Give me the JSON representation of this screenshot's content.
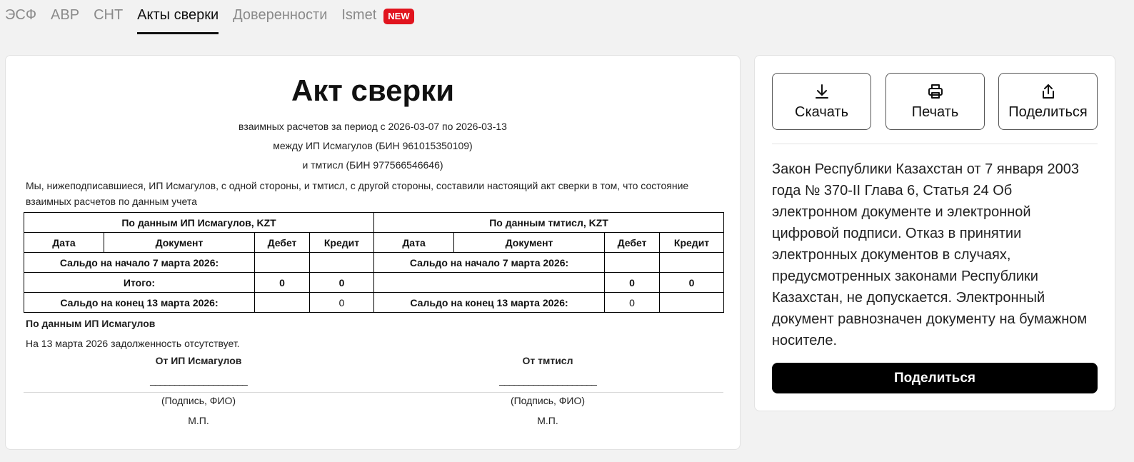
{
  "tabs": [
    {
      "label": "ЭСФ"
    },
    {
      "label": "АВР"
    },
    {
      "label": "СНТ"
    },
    {
      "label": "Акты сверки"
    },
    {
      "label": "Доверенности"
    },
    {
      "label": "Ismet",
      "badge": "NEW"
    }
  ],
  "document": {
    "title": "Акт сверки",
    "period_line": "взаимных расчетов за период с 2026-03-07 по 2026-03-13",
    "between_line": "между ИП Исмагулов (БИН 961015350109)",
    "and_line": "и тмтисл (БИН 977566546646)",
    "intro": "Мы, нижеподписавшиеся, ИП Исмагулов, с одной стороны, и тмтисл, с другой стороны, составили настоящий акт сверки в том, что состояние взаимных расчетов по данным учета",
    "table": {
      "left_header": "По данным ИП Исмагулов, KZT",
      "right_header": "По данным тмтисл, KZT",
      "col_date": "Дата",
      "col_doc": "Документ",
      "col_debit": "Дебет",
      "col_credit": "Кредит",
      "opening_label": "Сальдо на начало 7 марта 2026:",
      "total_label": "Итого:",
      "total_left_debit": "0",
      "total_left_credit": "0",
      "total_right_debit": "0",
      "total_right_credit": "0",
      "closing_label": "Сальдо на конец 13 марта 2026:",
      "closing_left_credit": "0",
      "closing_right_debit": "0"
    },
    "summary_heading": "По данным ИП Исмагулов",
    "summary_text": "На 13 марта 2026 задолженность отсутствует.",
    "signatures": {
      "left_name": "От ИП Исмагулов",
      "right_name": "От тмтисл",
      "line": "____________________",
      "caption": "(Подпись, ФИО)",
      "seal": "М.П."
    }
  },
  "side": {
    "download_label": "Скачать",
    "print_label": "Печать",
    "share_label": "Поделиться",
    "law_text": "Закон Республики Казахстан от 7 января 2003 года № 370-II Глава 6, Статья 24 Об электронном документе и электронной цифровой подписи. Отказ в принятии электронных документов в случаях, предусмотренных законами Республики Казахстан, не допускается. Электронный документ равнозначен документу на бумажном носителе.",
    "share_button": "Поделиться"
  },
  "colors": {
    "badge": "#e1141e",
    "primary_button": "#000000",
    "background": "#f2f2f2"
  }
}
